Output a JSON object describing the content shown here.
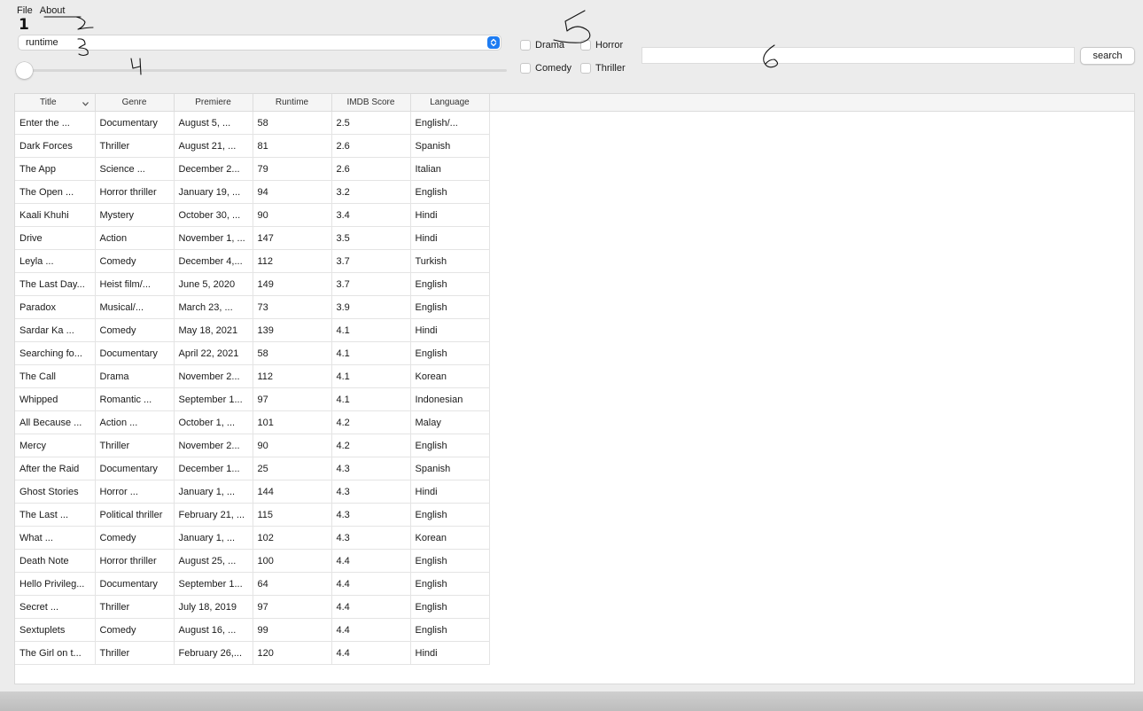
{
  "menu": {
    "file": "File",
    "about": "About"
  },
  "sort_select": {
    "value": "runtime"
  },
  "slider": {
    "value": 0
  },
  "genres": {
    "drama": "Drama",
    "horror": "Horror",
    "comedy": "Comedy",
    "thriller": "Thriller"
  },
  "search": {
    "value": "",
    "button_label": "search"
  },
  "table": {
    "columns": [
      "Title",
      "Genre",
      "Premiere",
      "Runtime",
      "IMDB Score",
      "Language"
    ],
    "rows": [
      [
        "Enter the ...",
        "Documentary",
        "August 5, ...",
        "58",
        "2.5",
        "English/..."
      ],
      [
        "Dark Forces",
        "Thriller",
        "August 21, ...",
        "81",
        "2.6",
        "Spanish"
      ],
      [
        "The App",
        "Science ...",
        "December 2...",
        "79",
        "2.6",
        "Italian"
      ],
      [
        "The Open ...",
        "Horror thriller",
        "January 19, ...",
        "94",
        "3.2",
        "English"
      ],
      [
        "Kaali Khuhi",
        "Mystery",
        "October 30, ...",
        "90",
        "3.4",
        "Hindi"
      ],
      [
        "Drive",
        "Action",
        "November 1, ...",
        "147",
        "3.5",
        "Hindi"
      ],
      [
        "Leyla ...",
        "Comedy",
        "December 4,...",
        "112",
        "3.7",
        "Turkish"
      ],
      [
        "The Last Day...",
        "Heist film/...",
        "June 5, 2020",
        "149",
        "3.7",
        "English"
      ],
      [
        "Paradox",
        "Musical/...",
        "March 23, ...",
        "73",
        "3.9",
        "English"
      ],
      [
        "Sardar Ka ...",
        "Comedy",
        "May 18, 2021",
        "139",
        "4.1",
        "Hindi"
      ],
      [
        "Searching fo...",
        "Documentary",
        "April 22, 2021",
        "58",
        "4.1",
        "English"
      ],
      [
        "The Call",
        "Drama",
        "November 2...",
        "112",
        "4.1",
        "Korean"
      ],
      [
        "Whipped",
        "Romantic ...",
        "September 1...",
        "97",
        "4.1",
        "Indonesian"
      ],
      [
        "All Because ...",
        "Action ...",
        "October 1, ...",
        "101",
        "4.2",
        "Malay"
      ],
      [
        "Mercy",
        "Thriller",
        "November 2...",
        "90",
        "4.2",
        "English"
      ],
      [
        "After the Raid",
        "Documentary",
        "December 1...",
        "25",
        "4.3",
        "Spanish"
      ],
      [
        "Ghost Stories",
        "Horror ...",
        "January 1, ...",
        "144",
        "4.3",
        "Hindi"
      ],
      [
        "The Last ...",
        "Political thriller",
        "February 21, ...",
        "115",
        "4.3",
        "English"
      ],
      [
        "What ...",
        "Comedy",
        "January 1, ...",
        "102",
        "4.3",
        "Korean"
      ],
      [
        "Death Note",
        "Horror thriller",
        "August 25, ...",
        "100",
        "4.4",
        "English"
      ],
      [
        "Hello Privileg...",
        "Documentary",
        "September 1...",
        "64",
        "4.4",
        "English"
      ],
      [
        "Secret ...",
        "Thriller",
        "July 18, 2019",
        "97",
        "4.4",
        "English"
      ],
      [
        "Sextuplets",
        "Comedy",
        "August 16, ...",
        "99",
        "4.4",
        "English"
      ],
      [
        "The Girl on t...",
        "Thriller",
        "February 26,...",
        "120",
        "4.4",
        "Hindi"
      ]
    ]
  },
  "annotations": {
    "n1": "1",
    "n2": "2",
    "n3": "3",
    "n4": "4",
    "n5": "5",
    "n6": "6"
  }
}
